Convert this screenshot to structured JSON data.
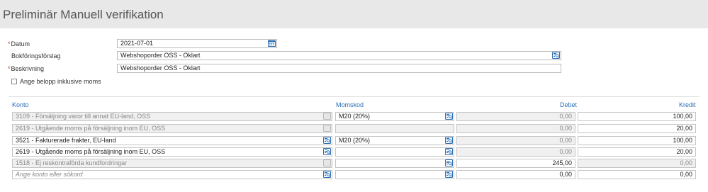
{
  "page": {
    "title": "Preliminär Manuell verifikation"
  },
  "form": {
    "required_marker": "*",
    "date": {
      "label": "Datum",
      "value": "2021-07-01"
    },
    "booking_proposal": {
      "label": "Bokföringsförslag",
      "value": "Webshoporder OSS - Oklart"
    },
    "description": {
      "label": "Beskrivning",
      "value": "Webshoporder OSS - Oklart"
    },
    "include_vat": {
      "label": "Ange belopp inklusive moms",
      "checked": false
    }
  },
  "table": {
    "headers": {
      "account": "Konto",
      "vat_code": "Momskod",
      "debit": "Debet",
      "credit": "Kredit"
    },
    "rows": [
      {
        "account": "3109 - Försäljning varor till annat EU-land, OSS",
        "vat_code": "M20 (20%)",
        "debit": "0,00",
        "credit": "100,00"
      },
      {
        "account": "2619 - Utgående moms på försäljning inom EU, OSS",
        "vat_code": "",
        "debit": "0,00",
        "credit": "20,00"
      },
      {
        "account": "3521 - Fakturerade frakter, EU-land",
        "vat_code": "M20 (20%)",
        "debit": "0,00",
        "credit": "100,00"
      },
      {
        "account": "2619 - Utgående moms på försäljning inom EU, OSS",
        "vat_code": "",
        "debit": "0,00",
        "credit": "20,00"
      },
      {
        "account": "1518 - Ej reskontraförda kundfordringar",
        "vat_code": "",
        "debit": "245,00",
        "credit": "0,00"
      },
      {
        "account": "",
        "vat_code": "",
        "debit": "0,00",
        "credit": "0,00"
      }
    ],
    "new_row_placeholder": "Ange konto eller sökord"
  },
  "icons": {
    "calendar": "calendar-icon",
    "search": "search-list-icon",
    "disabled_search": "disabled-list-icon"
  },
  "colors": {
    "accent": "#2a6eb5",
    "required": "#c0392b",
    "disabled_bg": "#f0f0f0"
  }
}
